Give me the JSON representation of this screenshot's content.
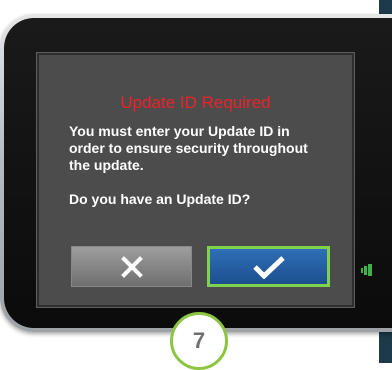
{
  "dialog": {
    "title": "Update ID Required",
    "message": "You must enter your Update ID in order to ensure security throughout the update.",
    "question": "Do you have an Update ID?",
    "cancel_icon": "close-icon",
    "confirm_icon": "checkmark-icon"
  },
  "device": {
    "status_icon": "battery-status-icon"
  },
  "step": {
    "number": "7"
  },
  "colors": {
    "title_red": "#ee2227",
    "confirm_blue": "#2b66ad",
    "confirm_border_green": "#7ed24d",
    "badge_green": "#8cc540",
    "screen_gray": "#4c4c4c"
  }
}
